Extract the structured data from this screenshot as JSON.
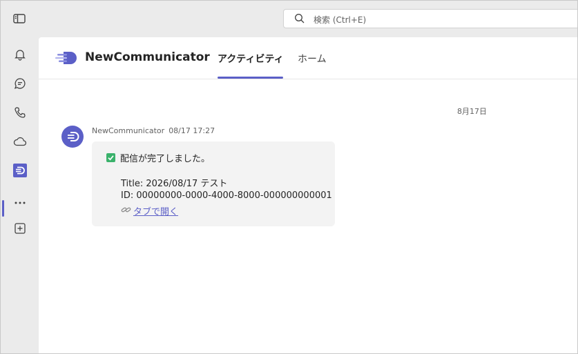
{
  "search": {
    "placeholder": "検索 (Ctrl+E)"
  },
  "rail": {
    "items": [
      "bell-icon",
      "chat-icon",
      "phone-icon",
      "cloud-icon",
      "app-icon",
      "more-icon",
      "add-icon"
    ]
  },
  "app": {
    "title": "NewCommunicator",
    "tabs": [
      {
        "label": "アクティビティ",
        "active": true
      },
      {
        "label": "ホーム",
        "active": false
      }
    ]
  },
  "feed": {
    "date_divider": "8月17日",
    "message": {
      "sender": "NewCommunicator",
      "time": "08/17 17:27",
      "status": "配信が完了しました。",
      "title_line": "Title: 2026/08/17 テスト",
      "id_line": "ID: 00000000-0000-4000-8000-000000000001",
      "link_label": "タブで開く"
    }
  },
  "colors": {
    "accent": "#5b5fc7",
    "success": "#3ab26b"
  }
}
